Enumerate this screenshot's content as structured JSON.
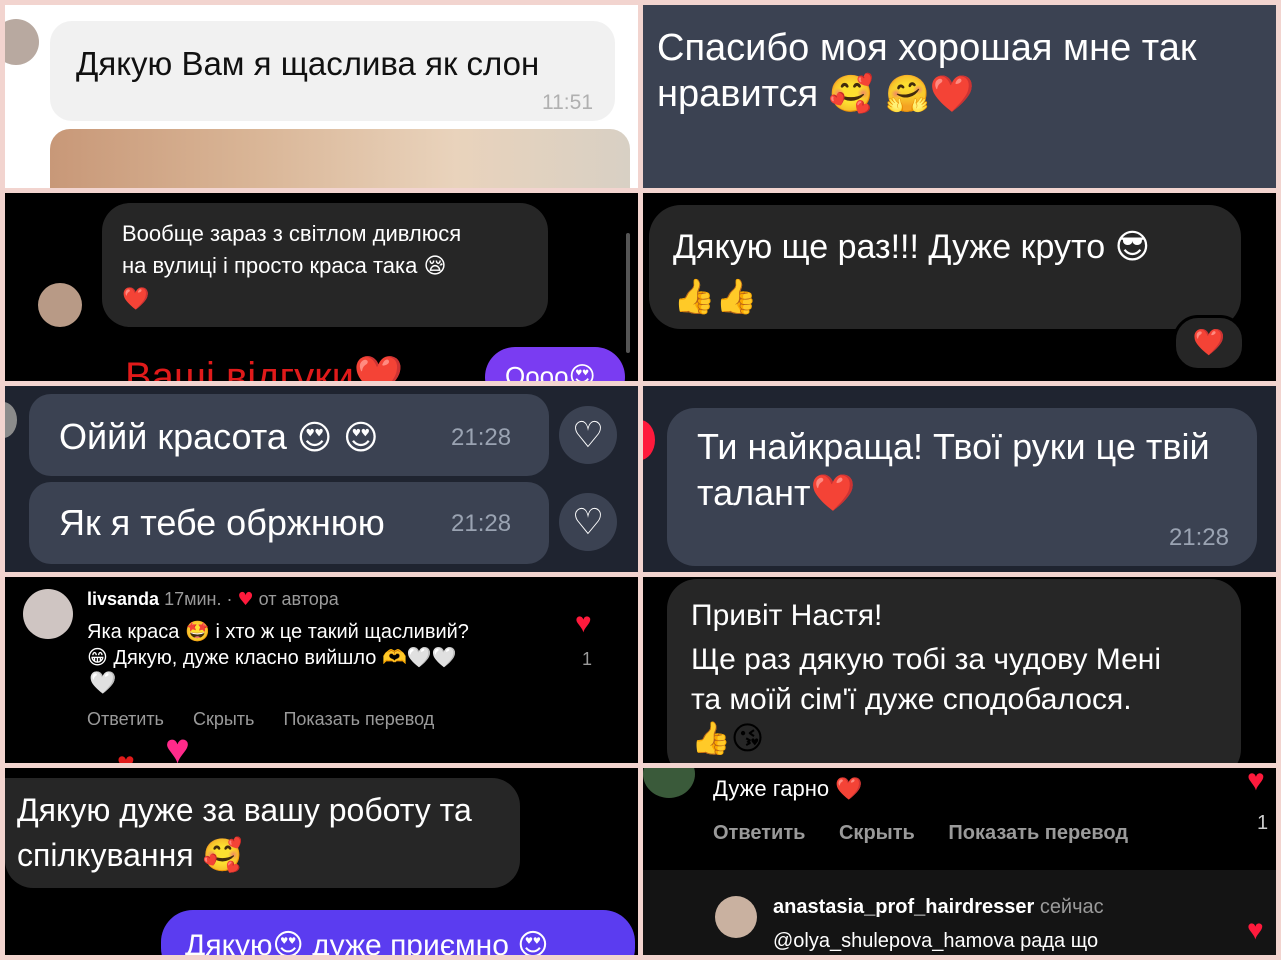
{
  "colors": {
    "border": "#f2d4cf",
    "dark_bg": "#000000",
    "telegram_bg": "#3b4252",
    "telegram_bubble": "#444b5a",
    "bubble_dark": "#262626",
    "bubble_grey": "#3a3a3c",
    "purple": "#6c3cf0",
    "red": "#ff1a3c"
  },
  "p1": {
    "text": "Дякую Вам я щаслива як слон",
    "time": "11:51"
  },
  "p2": {
    "line1": "Спасибо моя хорошая мне так",
    "line2": "нравится",
    "emojis": "🥰 🤗❤️"
  },
  "p3": {
    "line1": "Вообще зараз з світлом дивлюся",
    "line2": "на вулиці і просто краса така",
    "emoji1": "😪",
    "emoji2": "❤️",
    "bottom_text": "Ваші відгуки❤️",
    "bottom_bubble": "Оооо😍"
  },
  "p4": {
    "line1": "Дякую ще раз!!! Дуже круто",
    "emoji1": "😎",
    "emoji2": "👍👍",
    "reaction": "❤️"
  },
  "p5": {
    "msg1": "Оййй красота",
    "emoji1": "😍 😍",
    "time1": "21:28",
    "msg2": "Як я тебе обржнюю",
    "time2": "21:28",
    "heart": "♡"
  },
  "p6": {
    "line1": "Ти найкраща! Твої руки це твій",
    "line2": "талант",
    "emoji": "❤️",
    "time": "21:28"
  },
  "p7": {
    "username": "livsanda",
    "meta": "17мин. ·",
    "author": "от автора",
    "line1a": "Яка краса",
    "line1b": "і хто ж це такий щасливий?",
    "emoji_star": "🤩",
    "emoji_grin": "😁",
    "line2": "Дякую, дуже класно вийшло",
    "emoji_hands": "🫶🤍🤍",
    "emoji_white": "🤍",
    "reply": "Ответить",
    "hide": "Скрыть",
    "translate": "Показать перевод",
    "like_count": "1"
  },
  "p8": {
    "line1": "Привіт Настя!",
    "line2": "Ще раз дякую тобі за чудову Мені",
    "line3": "та моїй сім'ї дуже сподобалося.",
    "emojis": "👍😘"
  },
  "p9": {
    "line1": "Дякую дуже за вашу роботу та",
    "line2": "спілкування",
    "emoji": "🥰",
    "bottom_bubble": "Дякую😍 дуже приємно 😍"
  },
  "p10": {
    "comment": "Дуже гарно",
    "emoji": "❤️",
    "reply": "Ответить",
    "hide": "Скрыть",
    "translate": "Показать перевод",
    "like_count": "1",
    "username": "anastasia_prof_hairdresser",
    "time": "сейчас",
    "reply_text": "@olya_shulepova_hamova рада що"
  }
}
